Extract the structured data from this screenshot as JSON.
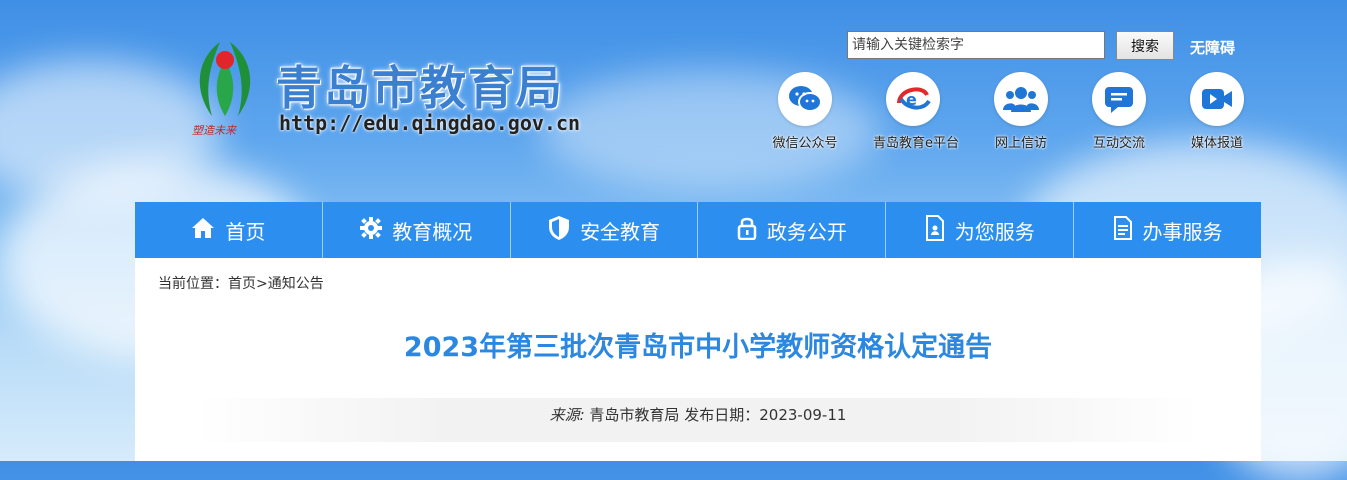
{
  "header": {
    "site_title": "青岛市教育局",
    "site_url": "http://edu.qingdao.gov.cn",
    "logo_caption": "塑造未来",
    "search_placeholder": "请输入关键检索字",
    "search_button": "搜索",
    "accessibility_link": "无障碍",
    "quick_links": [
      {
        "label": "微信公众号",
        "icon": "wechat-icon",
        "color": "#1f76d6"
      },
      {
        "label": "青岛教育e平台",
        "icon": "e-platform-icon",
        "color": "#1f76d6"
      },
      {
        "label": "网上信访",
        "icon": "users-icon",
        "color": "#1f76d6"
      },
      {
        "label": "互动交流",
        "icon": "message-icon",
        "color": "#1f76d6"
      },
      {
        "label": "媒体报道",
        "icon": "video-icon",
        "color": "#1f76d6"
      }
    ]
  },
  "nav": {
    "items": [
      {
        "label": "首页",
        "icon": "home-icon"
      },
      {
        "label": "教育概况",
        "icon": "gear-icon"
      },
      {
        "label": "安全教育",
        "icon": "shield-icon"
      },
      {
        "label": "政务公开",
        "icon": "lock-icon"
      },
      {
        "label": "为您服务",
        "icon": "document-person-icon"
      },
      {
        "label": "办事服务",
        "icon": "document-icon"
      }
    ]
  },
  "content": {
    "breadcrumb_prefix": "当前位置：",
    "breadcrumb_home": "首页",
    "breadcrumb_sep": ">",
    "breadcrumb_current": "通知公告",
    "title": "2023年第三批次青岛市中小学教师资格认定通告",
    "source_label": "来源:",
    "source_value": "青岛市教育局",
    "date_label": "发布日期：",
    "date_value": "2023-09-11"
  },
  "colors": {
    "nav_bg": "#2c8ff0",
    "title": "#2b87df",
    "brand_blue": "#3b7fd0"
  }
}
